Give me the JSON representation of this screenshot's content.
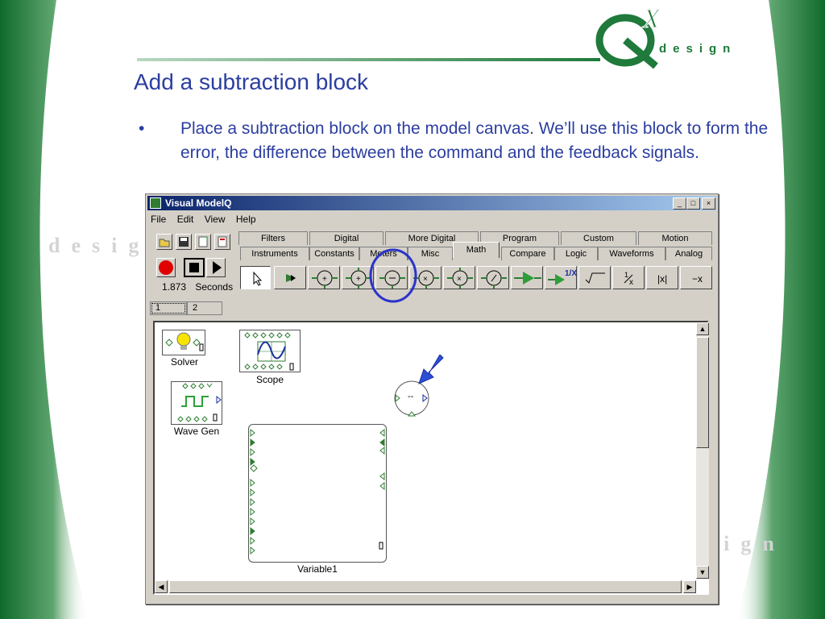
{
  "slide": {
    "title": "Add a subtraction block",
    "bullet_symbol": "•",
    "bullet_text": "Place a subtraction block on the model canvas.  We’ll use this block to form the error, the difference between the command and the feedback signals.",
    "logo_text": "design",
    "logo_mark": "QX",
    "watermark_text": "design",
    "colors": {
      "green": "#1f7a3b",
      "title_blue": "#2c3ea0",
      "highlight_circle": "#2b33c9"
    }
  },
  "window": {
    "title": "Visual ModelQ",
    "controls": [
      "_",
      "□",
      "×"
    ],
    "menu": [
      "File",
      "Edit",
      "View",
      "Help"
    ],
    "toolbar_icons": [
      "open-icon",
      "save-icon",
      "new-icon",
      "print-icon"
    ],
    "run": {
      "time": "1.873",
      "unit": "Seconds"
    },
    "tabs_row1": [
      "Filters",
      "Digital",
      "More Digital",
      "Program",
      "Custom",
      "Motion"
    ],
    "tabs_row2": [
      "Instruments",
      "Constants",
      "Meters",
      "Misc",
      "Math",
      "Compare",
      "Logic",
      "Waveforms",
      "Analog"
    ],
    "selected_tab": "Math",
    "palette": [
      {
        "icon": "pointer-icon",
        "label": ""
      },
      {
        "icon": "wire-tool-icon",
        "label": ""
      },
      {
        "icon": "sum-icon",
        "label": "+"
      },
      {
        "icon": "sum-three-icon",
        "label": "+"
      },
      {
        "icon": "subtraction-icon",
        "label": "-"
      },
      {
        "icon": "multiply-icon",
        "label": "×"
      },
      {
        "icon": "multiply-three-icon",
        "label": "×"
      },
      {
        "icon": "divide-icon",
        "label": "/"
      },
      {
        "icon": "gain-icon",
        "label": ""
      },
      {
        "icon": "reciprocal-icon",
        "label": "1/X"
      },
      {
        "icon": "square-root-icon",
        "label": "√"
      },
      {
        "icon": "inverse-icon",
        "label": "1/x"
      },
      {
        "icon": "absolute-icon",
        "label": "|x|"
      },
      {
        "icon": "negate-icon",
        "label": "-x"
      }
    ],
    "canvas_tabs": [
      "1",
      "2"
    ],
    "blocks": {
      "solver": "Solver",
      "scope": "Scope",
      "wave_gen": "Wave Gen",
      "variable": "Variable1",
      "subtract_symbol": "--"
    }
  }
}
